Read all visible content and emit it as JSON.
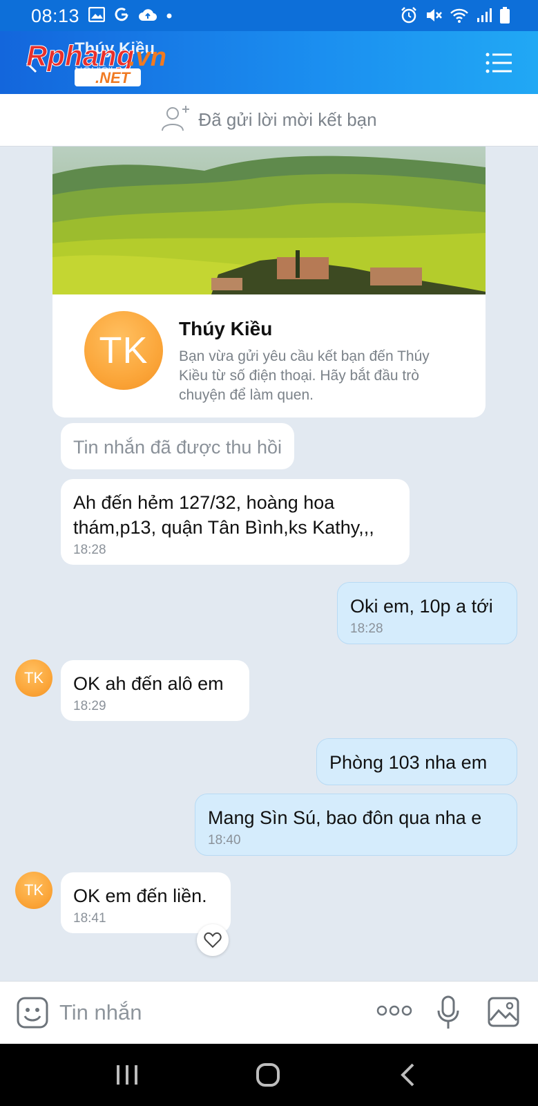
{
  "status_bar": {
    "time": "08:13",
    "left_icons": [
      "image-icon",
      "google-icon",
      "cloud-upload-icon",
      "dot-icon"
    ],
    "right_icons": [
      "alarm-icon",
      "mute-icon",
      "wifi-icon",
      "signal-icon",
      "battery-icon"
    ]
  },
  "header": {
    "title": "Thúy Kiều",
    "subtitle": "NGƯỜI LẠ",
    "watermark": "Rphang.vn .NET"
  },
  "friend_banner": {
    "text": "Đã gửi lời mời kết bạn"
  },
  "profile_card": {
    "avatar_initials": "TK",
    "name": "Thúy Kiều",
    "description": "Bạn vừa gửi yêu cầu kết bạn đến Thúy Kiều từ số điện thoại. Hãy bắt đầu trò chuyện để làm quen."
  },
  "messages": [
    {
      "direction": "in",
      "text": "Tin nhắn đã được thu hồi",
      "recalled": true
    },
    {
      "direction": "in",
      "text": "Ah đến hẻm 127/32, hoàng hoa thám,p13, quận Tân Bình,ks Kathy,,,",
      "time": "18:28"
    },
    {
      "direction": "out",
      "text": "Oki em, 10p a tới",
      "time": "18:28"
    },
    {
      "direction": "in",
      "avatar": "TK",
      "text": "OK ah đến alô em",
      "time": "18:29"
    },
    {
      "direction": "out",
      "text": "Phòng 103 nha em"
    },
    {
      "direction": "out",
      "text": "Mang Sìn Sú, bao đôn qua nha e",
      "time": "18:40"
    },
    {
      "direction": "in",
      "avatar": "TK",
      "text": "OK em đến liền.",
      "time": "18:41"
    }
  ],
  "input_bar": {
    "placeholder": "Tin nhắn"
  },
  "colors": {
    "header_blue": "#1366dc",
    "out_bubble": "#d5ecfc",
    "chat_background": "#e2e9f1",
    "avatar_orange": "#fba63a"
  }
}
